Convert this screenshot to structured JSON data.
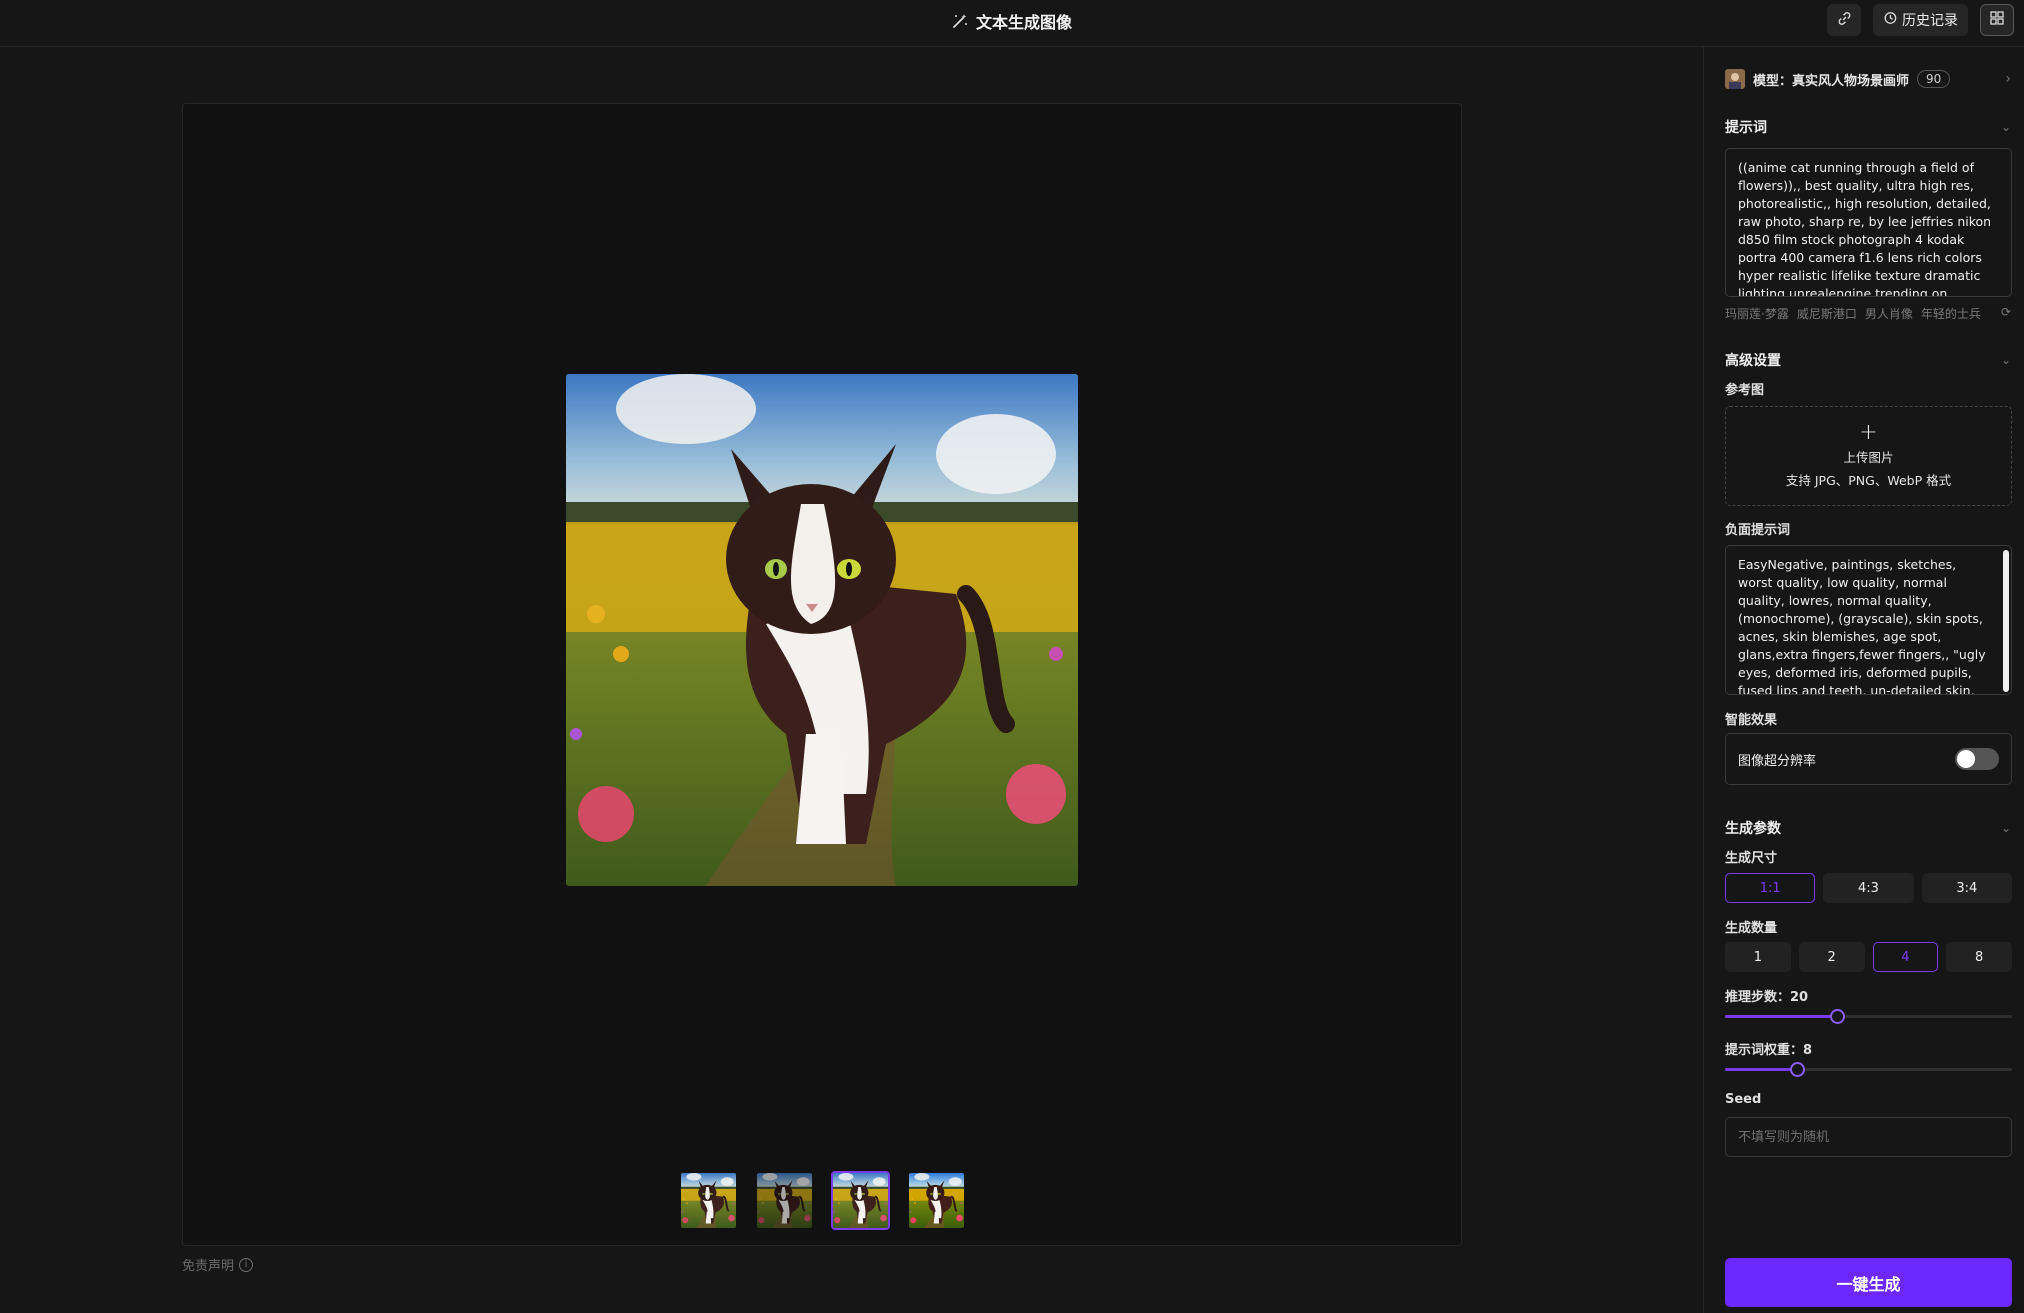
{
  "header": {
    "title": "文本生成图像",
    "history_label": "历史记录"
  },
  "main": {
    "selected_thumb": 2,
    "thumbs": [
      "cat-field-1",
      "cat-path-2",
      "cat-field-3",
      "cat-field-4"
    ],
    "disclaimer": "免责声明"
  },
  "panel": {
    "model_label": "模型：真实风人物场景画师",
    "model_badge": "90",
    "prompt": {
      "title": "提示词",
      "value": "((anime cat running through a field of flowers)),, best quality, ultra high res, photorealistic,, high resolution, detailed, raw photo, sharp re, by lee jeffries nikon d850 film stock photograph 4 kodak portra 400 camera f1.6 lens rich colors hyper realistic lifelike texture dramatic lighting unrealengine trending on artstation",
      "tags": [
        "玛丽莲·梦露",
        "威尼斯港口",
        "男人肖像",
        "年轻的士兵"
      ]
    },
    "advanced": {
      "title": "高级设置",
      "reference_label": "参考图",
      "upload_label": "上传图片",
      "upload_hint": "支持 JPG、PNG、WebP 格式",
      "negative_label": "负面提示词",
      "negative_value": "EasyNegative, paintings, sketches, worst quality, low quality, normal quality, lowres, normal quality, (monochrome), (grayscale), skin spots, acnes, skin blemishes, age spot, glans,extra fingers,fewer fingers,, \"ugly eyes, deformed iris, deformed pupils, fused lips and teeth, un-detailed skin, semi-",
      "smart_label": "智能效果",
      "superres_label": "图像超分辨率",
      "superres_on": false
    },
    "params": {
      "title": "生成参数",
      "size_label": "生成尺寸",
      "sizes": [
        "1:1",
        "4:3",
        "3:4"
      ],
      "size_selected": 0,
      "count_label": "生成数量",
      "counts": [
        "1",
        "2",
        "4",
        "8"
      ],
      "count_selected": 2,
      "steps_label": "推理步数：",
      "steps_value": "20",
      "steps_fraction": 0.39,
      "weight_label": "提示词权重：",
      "weight_value": "8",
      "weight_fraction": 0.25,
      "seed_label": "Seed",
      "seed_placeholder": "不填写则为随机"
    },
    "generate_label": "一键生成"
  },
  "colors": {
    "accent": "#7c3aed",
    "button": "#6d28ff",
    "background": "#161616"
  },
  "icons": [
    "wand-icon",
    "link-icon",
    "history-icon",
    "grid-icon",
    "chevron-right-icon",
    "chevron-down-icon",
    "refresh-icon",
    "plus-icon",
    "info-icon"
  ]
}
